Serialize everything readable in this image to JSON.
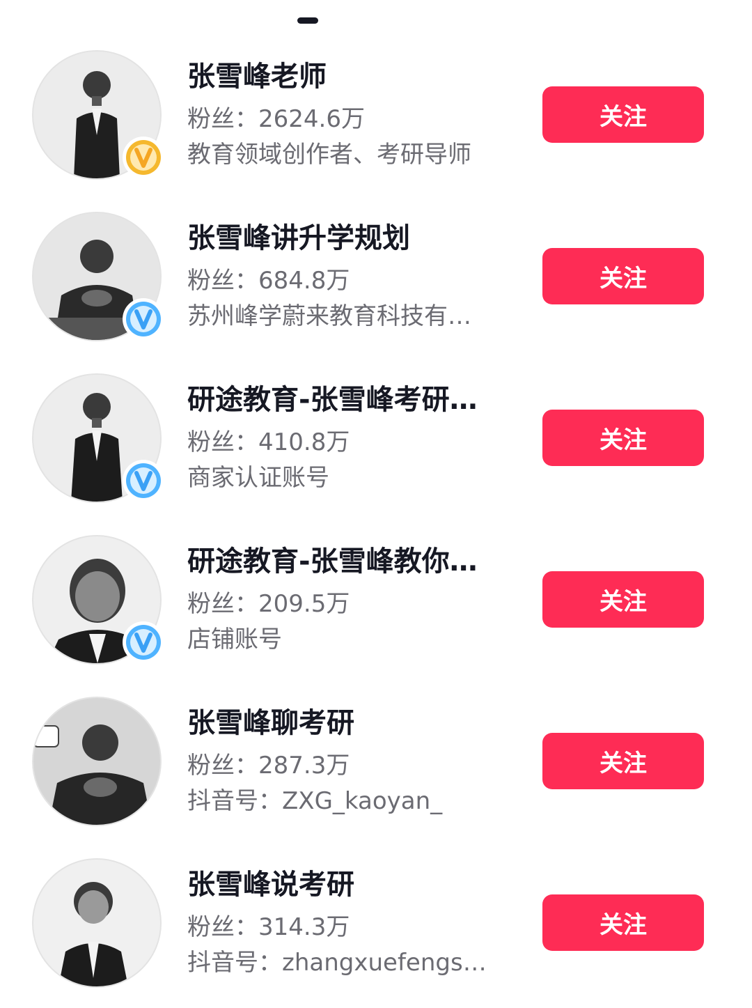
{
  "accounts": [
    {
      "name": "张雪峰老师",
      "fans_label": "粉丝：",
      "fans": "2624.6万",
      "desc": "教育领域创作者、考研导师",
      "follow_label": "关注",
      "badge": "gold-v-badge",
      "badge_color": "#f5b82e"
    },
    {
      "name": "张雪峰讲升学规划",
      "fans_label": "粉丝：",
      "fans": "684.8万",
      "desc": "苏州峰学蔚来教育科技有…",
      "follow_label": "关注",
      "badge": "blue-v-badge",
      "badge_color": "#4fb3ff"
    },
    {
      "name": "研途教育-张雪峰考研…",
      "fans_label": "粉丝：",
      "fans": "410.8万",
      "desc": "商家认证账号",
      "follow_label": "关注",
      "badge": "blue-v-badge",
      "badge_color": "#4fb3ff"
    },
    {
      "name": "研途教育-张雪峰教你…",
      "fans_label": "粉丝：",
      "fans": "209.5万",
      "desc": "店铺账号",
      "follow_label": "关注",
      "badge": "blue-v-badge",
      "badge_color": "#4fb3ff"
    },
    {
      "name": "张雪峰聊考研",
      "fans_label": "粉丝：",
      "fans": "287.3万",
      "desc": "抖音号：ZXG_kaoyan_",
      "follow_label": "关注",
      "badge": "",
      "badge_color": ""
    },
    {
      "name": "张雪峰说考研",
      "fans_label": "粉丝：",
      "fans": "314.3万",
      "desc": "抖音号：zhangxuefengshuo",
      "follow_label": "关注",
      "badge": "",
      "badge_color": ""
    }
  ],
  "colors": {
    "follow_button": "#fe2c55",
    "name_text": "#161823",
    "secondary_text": "#6b6b72"
  }
}
